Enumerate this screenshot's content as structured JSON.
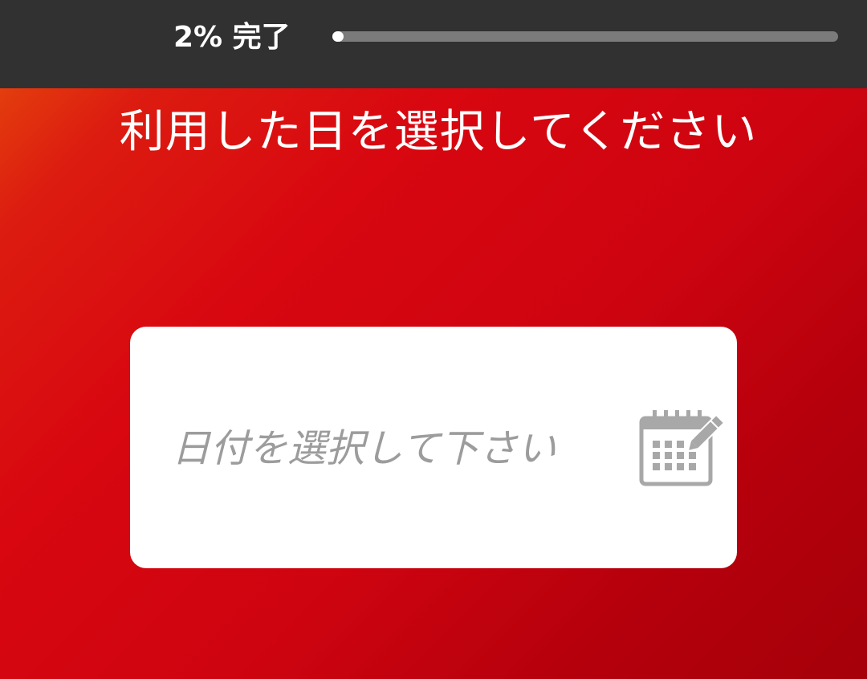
{
  "progress": {
    "label": "2% 完了",
    "percent": 2
  },
  "question": {
    "title": "利用した日を選択してください"
  },
  "date_picker": {
    "placeholder": "日付を選択して下さい",
    "icon": "calendar-edit-icon"
  },
  "colors": {
    "topbar": "#313131",
    "gradient_start": "#e8520c",
    "gradient_mid": "#d80710",
    "gradient_end": "#a5000a",
    "progress_track": "#7b7b7b",
    "progress_fill": "#ffffff",
    "placeholder_text": "#9c9c9c",
    "icon_gray": "#a8a8a8"
  }
}
